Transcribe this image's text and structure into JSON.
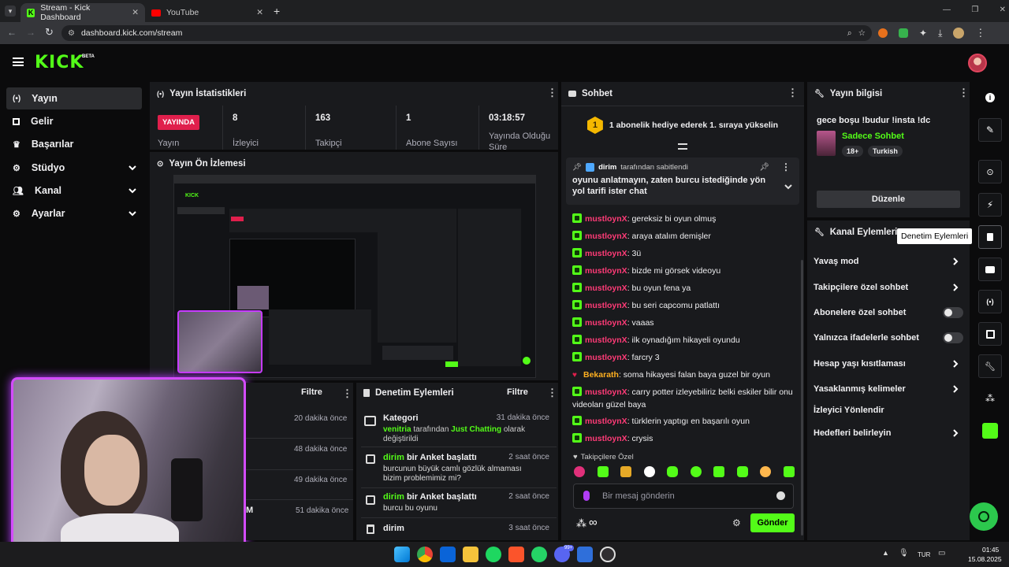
{
  "browser": {
    "tabs": [
      {
        "title": "Stream - Kick Dashboard"
      },
      {
        "title": "YouTube"
      }
    ],
    "url": "dashboard.kick.com/stream"
  },
  "kick": {
    "logo": "KICK",
    "beta": "BETA"
  },
  "sidebar": {
    "items": [
      {
        "label": "Yayın",
        "icon": "broadcast-icon",
        "active": true
      },
      {
        "label": "Gelir",
        "icon": "revenue-icon"
      },
      {
        "label": "Başarılar",
        "icon": "trophy-icon"
      },
      {
        "label": "Stüdyo",
        "icon": "studio-icon",
        "expandable": true
      },
      {
        "label": "Kanal",
        "icon": "users-icon",
        "expandable": true
      },
      {
        "label": "Ayarlar",
        "icon": "settings-icon",
        "expandable": true
      }
    ]
  },
  "stats": {
    "title": "Yayın İstatistikleri",
    "live_badge": "YAYINDA",
    "stream_label": "Yayın",
    "items": [
      {
        "value": "8",
        "label": "İzleyici"
      },
      {
        "value": "163",
        "label": "Takipçi"
      },
      {
        "value": "1",
        "label": "Abone Sayısı"
      },
      {
        "value": "03:18:57",
        "label": "Yayında Olduğu Süre"
      }
    ]
  },
  "preview": {
    "title": "Yayın Ön İzlemesi"
  },
  "activity": {
    "filter": "Filtre",
    "times": [
      "20 dakika önce",
      "48 dakika önce",
      "49 dakika önce",
      "51 dakika önce"
    ],
    "partial": "M"
  },
  "moderation": {
    "title": "Denetim Eylemleri",
    "filter": "Filtre",
    "items": [
      {
        "title": "Kategori",
        "time": "31 dakika önce",
        "by": "venitria",
        "mid": " tarafından ",
        "cat": "Just Chatting",
        "tail": " olarak değiştirildi"
      },
      {
        "user": "dirim",
        "action": " bir Anket başlattı",
        "time": "2 saat önce",
        "desc": "burcunun büyük camlı gözlük almaması bizim problemimiz mi?"
      },
      {
        "user": "dirim",
        "action": " bir Anket başlattı",
        "time": "2 saat önce",
        "desc": "burcu bu oyunu"
      },
      {
        "title": "dirim",
        "time": "3 saat önce"
      }
    ]
  },
  "chat": {
    "title": "Sohbet",
    "gift_banner": "1 abonelik hediye ederek 1. sıraya yükselin",
    "gift_rank": "1",
    "pinned": {
      "user": "dirim",
      "label": " tarafından sabitlendi",
      "text": "oyunu anlatmayın, zaten burcu istediğinde yön yol tarifi ister chat"
    },
    "messages": [
      {
        "user": "mustloynX",
        "text": ": gereksiz bi oyun olmuş"
      },
      {
        "user": "mustloynX",
        "text": ": araya atalım demişler"
      },
      {
        "user": "mustloynX",
        "text": ": 3ü"
      },
      {
        "user": "mustloynX",
        "text": ": bizde mi görsek videoyu"
      },
      {
        "user": "mustloynX",
        "text": ": bu oyun fena ya"
      },
      {
        "user": "mustloynX",
        "text": ": bu seri capcomu patlattı"
      },
      {
        "user": "mustloynX",
        "text": ": vaaas"
      },
      {
        "user": "mustloynX",
        "text": ": ilk oynadığım hikayeli oyundu"
      },
      {
        "user": "mustloynX",
        "text": ": farcry 3"
      },
      {
        "user": "Bekarath",
        "text": ": soma hikayesi falan baya guzel bir oyun"
      },
      {
        "user": "mustloynX",
        "text": ": carry potter izleyebiliriz belki eskiler bilir onu videoları güzel baya"
      },
      {
        "user": "mustloynX",
        "text": ": türklerin yaptıgı en başarılı oyun"
      },
      {
        "user": "mustloynX",
        "text": ": crysis"
      }
    ],
    "followers_only": "Takipçilere Özel",
    "input_placeholder": "Bir mesaj gönderin",
    "send": "Gönder"
  },
  "stream_info": {
    "title": "Yayın bilgisi",
    "stream_title": "gece boşu !budur !insta !dc",
    "category": "Sadece Sohbet",
    "tags": [
      "18+",
      "Turkish"
    ],
    "edit": "Düzenle"
  },
  "channel_actions": {
    "title": "Kanal Eylemleri",
    "tooltip": "Denetim Eylemleri",
    "items": [
      {
        "label": "Yavaş mod",
        "type": "arrow"
      },
      {
        "label": "Takipçilere özel sohbet",
        "type": "arrow"
      },
      {
        "label": "Abonelere özel sohbet",
        "type": "toggle"
      },
      {
        "label": "Yalnızca ifadelerle sohbet",
        "type": "toggle"
      },
      {
        "label": "Hesap yaşı kısıtlaması",
        "type": "arrow"
      },
      {
        "label": "Yasaklanmış kelimeler",
        "type": "arrow"
      },
      {
        "label": "İzleyici Yönlendir",
        "type": "none"
      },
      {
        "label": "Hedefleri belirleyin",
        "type": "arrow"
      }
    ]
  },
  "taskbar": {
    "lang": "TUR",
    "time": "01:45",
    "date": "15.08.2025",
    "badge": "99+"
  },
  "colors": {
    "accent": "#53fc18",
    "live": "#e01f4c",
    "username": "#ff3b77"
  }
}
